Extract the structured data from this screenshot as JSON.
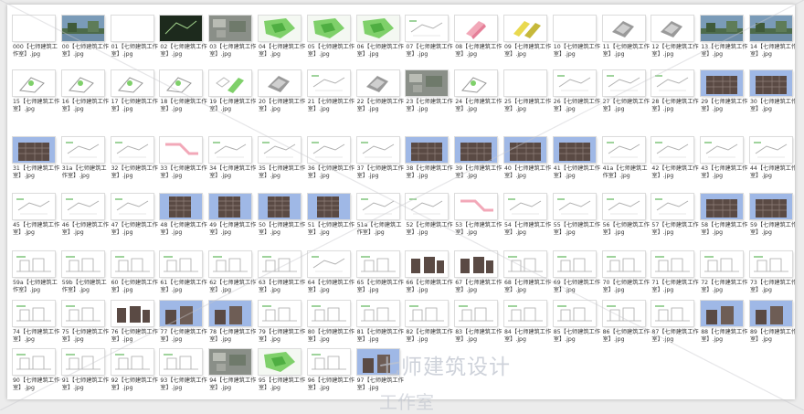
{
  "files": [
    {
      "label": "000【七师建筑工作室】.jpg",
      "kind": "blank"
    },
    {
      "label": "00【七师建筑工作室】.jpg",
      "kind": "photo"
    },
    {
      "label": "01【七师建筑工作室】.jpg",
      "kind": "blank"
    },
    {
      "label": "02【七师建筑工作室】.jpg",
      "kind": "sketch"
    },
    {
      "label": "03【七师建筑工作室】.jpg",
      "kind": "aerial"
    },
    {
      "label": "04【七师建筑工作室】.jpg",
      "kind": "greenmap"
    },
    {
      "label": "05【七师建筑工作室】.jpg",
      "kind": "greenmap"
    },
    {
      "label": "06【七师建筑工作室】.jpg",
      "kind": "greenmap"
    },
    {
      "label": "07【七师建筑工作室】.jpg",
      "kind": "plan"
    },
    {
      "label": "08【七师建筑工作室】.jpg",
      "kind": "pink3d"
    },
    {
      "label": "09【七师建筑工作室】.jpg",
      "kind": "yellow3d"
    },
    {
      "label": "10【七师建筑工作室】.jpg",
      "kind": "blank"
    },
    {
      "label": "11【七师建筑工作室】.jpg",
      "kind": "model"
    },
    {
      "label": "12【七师建筑工作室】.jpg",
      "kind": "model"
    },
    {
      "label": "13【七师建筑工作室】.jpg",
      "kind": "photo"
    },
    {
      "label": "14【七师建筑工作室】.jpg",
      "kind": "photo"
    },
    {
      "label": "15【七师建筑工作室】.jpg",
      "kind": "diagram"
    },
    {
      "label": "16【七师建筑工作室】.jpg",
      "kind": "diagram"
    },
    {
      "label": "17【七师建筑工作室】.jpg",
      "kind": "diagram"
    },
    {
      "label": "18【七师建筑工作室】.jpg",
      "kind": "diagram"
    },
    {
      "label": "19【七师建筑工作室】.jpg",
      "kind": "green3d"
    },
    {
      "label": "20【七师建筑工作室】.jpg",
      "kind": "model"
    },
    {
      "label": "21【七师建筑工作室】.jpg",
      "kind": "plan"
    },
    {
      "label": "22【七师建筑工作室】.jpg",
      "kind": "model"
    },
    {
      "label": "23【七师建筑工作室】.jpg",
      "kind": "aerial"
    },
    {
      "label": "24【七师建筑工作室】.jpg",
      "kind": "diagram"
    },
    {
      "label": "25【七师建筑工作室】.jpg",
      "kind": "blank"
    },
    {
      "label": "26【七师建筑工作室】.jpg",
      "kind": "plan"
    },
    {
      "label": "27【七师建筑工作室】.jpg",
      "kind": "plan"
    },
    {
      "label": "28【七师建筑工作室】.jpg",
      "kind": "plan"
    },
    {
      "label": "29【七师建筑工作室】.jpg",
      "kind": "facade"
    },
    {
      "label": "30【七师建筑工作室】.jpg",
      "kind": "facade"
    },
    {
      "label": "31【七师建筑工作室】.jpg",
      "kind": "facade"
    },
    {
      "label": "31a【七师建筑工作室】.jpg",
      "kind": "plan"
    },
    {
      "label": "32【七师建筑工作室】.jpg",
      "kind": "plan"
    },
    {
      "label": "33【七师建筑工作室】.jpg",
      "kind": "pinkplan"
    },
    {
      "label": "34【七师建筑工作室】.jpg",
      "kind": "plan"
    },
    {
      "label": "35【七师建筑工作室】.jpg",
      "kind": "plan"
    },
    {
      "label": "36【七师建筑工作室】.jpg",
      "kind": "plan"
    },
    {
      "label": "37【七师建筑工作室】.jpg",
      "kind": "plan"
    },
    {
      "label": "38【七师建筑工作室】.jpg",
      "kind": "facade"
    },
    {
      "label": "39【七师建筑工作室】.jpg",
      "kind": "facade"
    },
    {
      "label": "40【七师建筑工作室】.jpg",
      "kind": "facade"
    },
    {
      "label": "41【七师建筑工作室】.jpg",
      "kind": "facade"
    },
    {
      "label": "41a【七师建筑工作室】.jpg",
      "kind": "plan"
    },
    {
      "label": "42【七师建筑工作室】.jpg",
      "kind": "plan"
    },
    {
      "label": "43【七师建筑工作室】.jpg",
      "kind": "plan"
    },
    {
      "label": "44【七师建筑工作室】.jpg",
      "kind": "plan"
    },
    {
      "label": "45【七师建筑工作室】.jpg",
      "kind": "plan"
    },
    {
      "label": "46【七师建筑工作室】.jpg",
      "kind": "plan"
    },
    {
      "label": "47【七师建筑工作室】.jpg",
      "kind": "plan"
    },
    {
      "label": "48【七师建筑工作室】.jpg",
      "kind": "tower"
    },
    {
      "label": "49【七师建筑工作室】.jpg",
      "kind": "tower"
    },
    {
      "label": "50【七师建筑工作室】.jpg",
      "kind": "tower"
    },
    {
      "label": "51【七师建筑工作室】.jpg",
      "kind": "tower"
    },
    {
      "label": "51a【七师建筑工作室】.jpg",
      "kind": "plan"
    },
    {
      "label": "52【七师建筑工作室】.jpg",
      "kind": "plan"
    },
    {
      "label": "53【七师建筑工作室】.jpg",
      "kind": "pinkplan"
    },
    {
      "label": "54【七师建筑工作室】.jpg",
      "kind": "plan"
    },
    {
      "label": "55【七师建筑工作室】.jpg",
      "kind": "plan"
    },
    {
      "label": "56【七师建筑工作室】.jpg",
      "kind": "plan"
    },
    {
      "label": "57【七师建筑工作室】.jpg",
      "kind": "plan"
    },
    {
      "label": "58【七师建筑工作室】.jpg",
      "kind": "facade"
    },
    {
      "label": "59【七师建筑工作室】.jpg",
      "kind": "facade"
    },
    {
      "label": "59a【七师建筑工作室】.jpg",
      "kind": "elev"
    },
    {
      "label": "59b【七师建筑工作室】.jpg",
      "kind": "elev"
    },
    {
      "label": "60【七师建筑工作室】.jpg",
      "kind": "elev"
    },
    {
      "label": "61【七师建筑工作室】.jpg",
      "kind": "elev"
    },
    {
      "label": "62【七师建筑工作室】.jpg",
      "kind": "elev"
    },
    {
      "label": "63【七师建筑工作室】.jpg",
      "kind": "elev"
    },
    {
      "label": "64【七师建筑工作室】.jpg",
      "kind": "plan"
    },
    {
      "label": "65【七师建筑工作室】.jpg",
      "kind": "elev"
    },
    {
      "label": "66【七师建筑工作室】.jpg",
      "kind": "darkelev"
    },
    {
      "label": "67【七师建筑工作室】.jpg",
      "kind": "darkelev"
    },
    {
      "label": "68【七师建筑工作室】.jpg",
      "kind": "elev"
    },
    {
      "label": "69【七师建筑工作室】.jpg",
      "kind": "elev"
    },
    {
      "label": "70【七师建筑工作室】.jpg",
      "kind": "elev"
    },
    {
      "label": "71【七师建筑工作室】.jpg",
      "kind": "elev"
    },
    {
      "label": "72【七师建筑工作室】.jpg",
      "kind": "elev"
    },
    {
      "label": "73【七师建筑工作室】.jpg",
      "kind": "elev"
    },
    {
      "label": "74【七师建筑工作室】.jpg",
      "kind": "elev"
    },
    {
      "label": "75【七师建筑工作室】.jpg",
      "kind": "elev"
    },
    {
      "label": "76【七师建筑工作室】.jpg",
      "kind": "darkelev"
    },
    {
      "label": "77【七师建筑工作室】.jpg",
      "kind": "skyelev"
    },
    {
      "label": "78【七师建筑工作室】.jpg",
      "kind": "skyelev"
    },
    {
      "label": "79【七师建筑工作室】.jpg",
      "kind": "elev"
    },
    {
      "label": "80【七师建筑工作室】.jpg",
      "kind": "elev"
    },
    {
      "label": "81【七师建筑工作室】.jpg",
      "kind": "elev"
    },
    {
      "label": "82【七师建筑工作室】.jpg",
      "kind": "elev"
    },
    {
      "label": "83【七师建筑工作室】.jpg",
      "kind": "elev"
    },
    {
      "label": "84【七师建筑工作室】.jpg",
      "kind": "elev"
    },
    {
      "label": "85【七师建筑工作室】.jpg",
      "kind": "elev"
    },
    {
      "label": "86【七师建筑工作室】.jpg",
      "kind": "elev"
    },
    {
      "label": "87【七师建筑工作室】.jpg",
      "kind": "elev"
    },
    {
      "label": "88【七师建筑工作室】.jpg",
      "kind": "skyelev"
    },
    {
      "label": "89【七师建筑工作室】.jpg",
      "kind": "skyelev"
    },
    {
      "label": "90【七师建筑工作室】.jpg",
      "kind": "elev"
    },
    {
      "label": "91【七师建筑工作室】.jpg",
      "kind": "elev"
    },
    {
      "label": "92【七师建筑工作室】.jpg",
      "kind": "elev"
    },
    {
      "label": "93【七师建筑工作室】.jpg",
      "kind": "elev"
    },
    {
      "label": "94【七师建筑工作室】.jpg",
      "kind": "aerial"
    },
    {
      "label": "95【七师建筑工作室】.jpg",
      "kind": "greenmap"
    },
    {
      "label": "96【七师建筑工作室】.jpg",
      "kind": "elev"
    },
    {
      "label": "97【七师建筑工作室】.jpg",
      "kind": "skyelev"
    }
  ],
  "watermark": {
    "line1": "七师建筑设计",
    "line2": "工作室"
  },
  "colors": {
    "panel": "#ffffff",
    "background": "#ececec",
    "sky": "#9fb8e6",
    "green": "#7fd06a",
    "pink": "#f2a8b8",
    "yellow": "#e9d94f",
    "facade": "#5a4a44"
  }
}
